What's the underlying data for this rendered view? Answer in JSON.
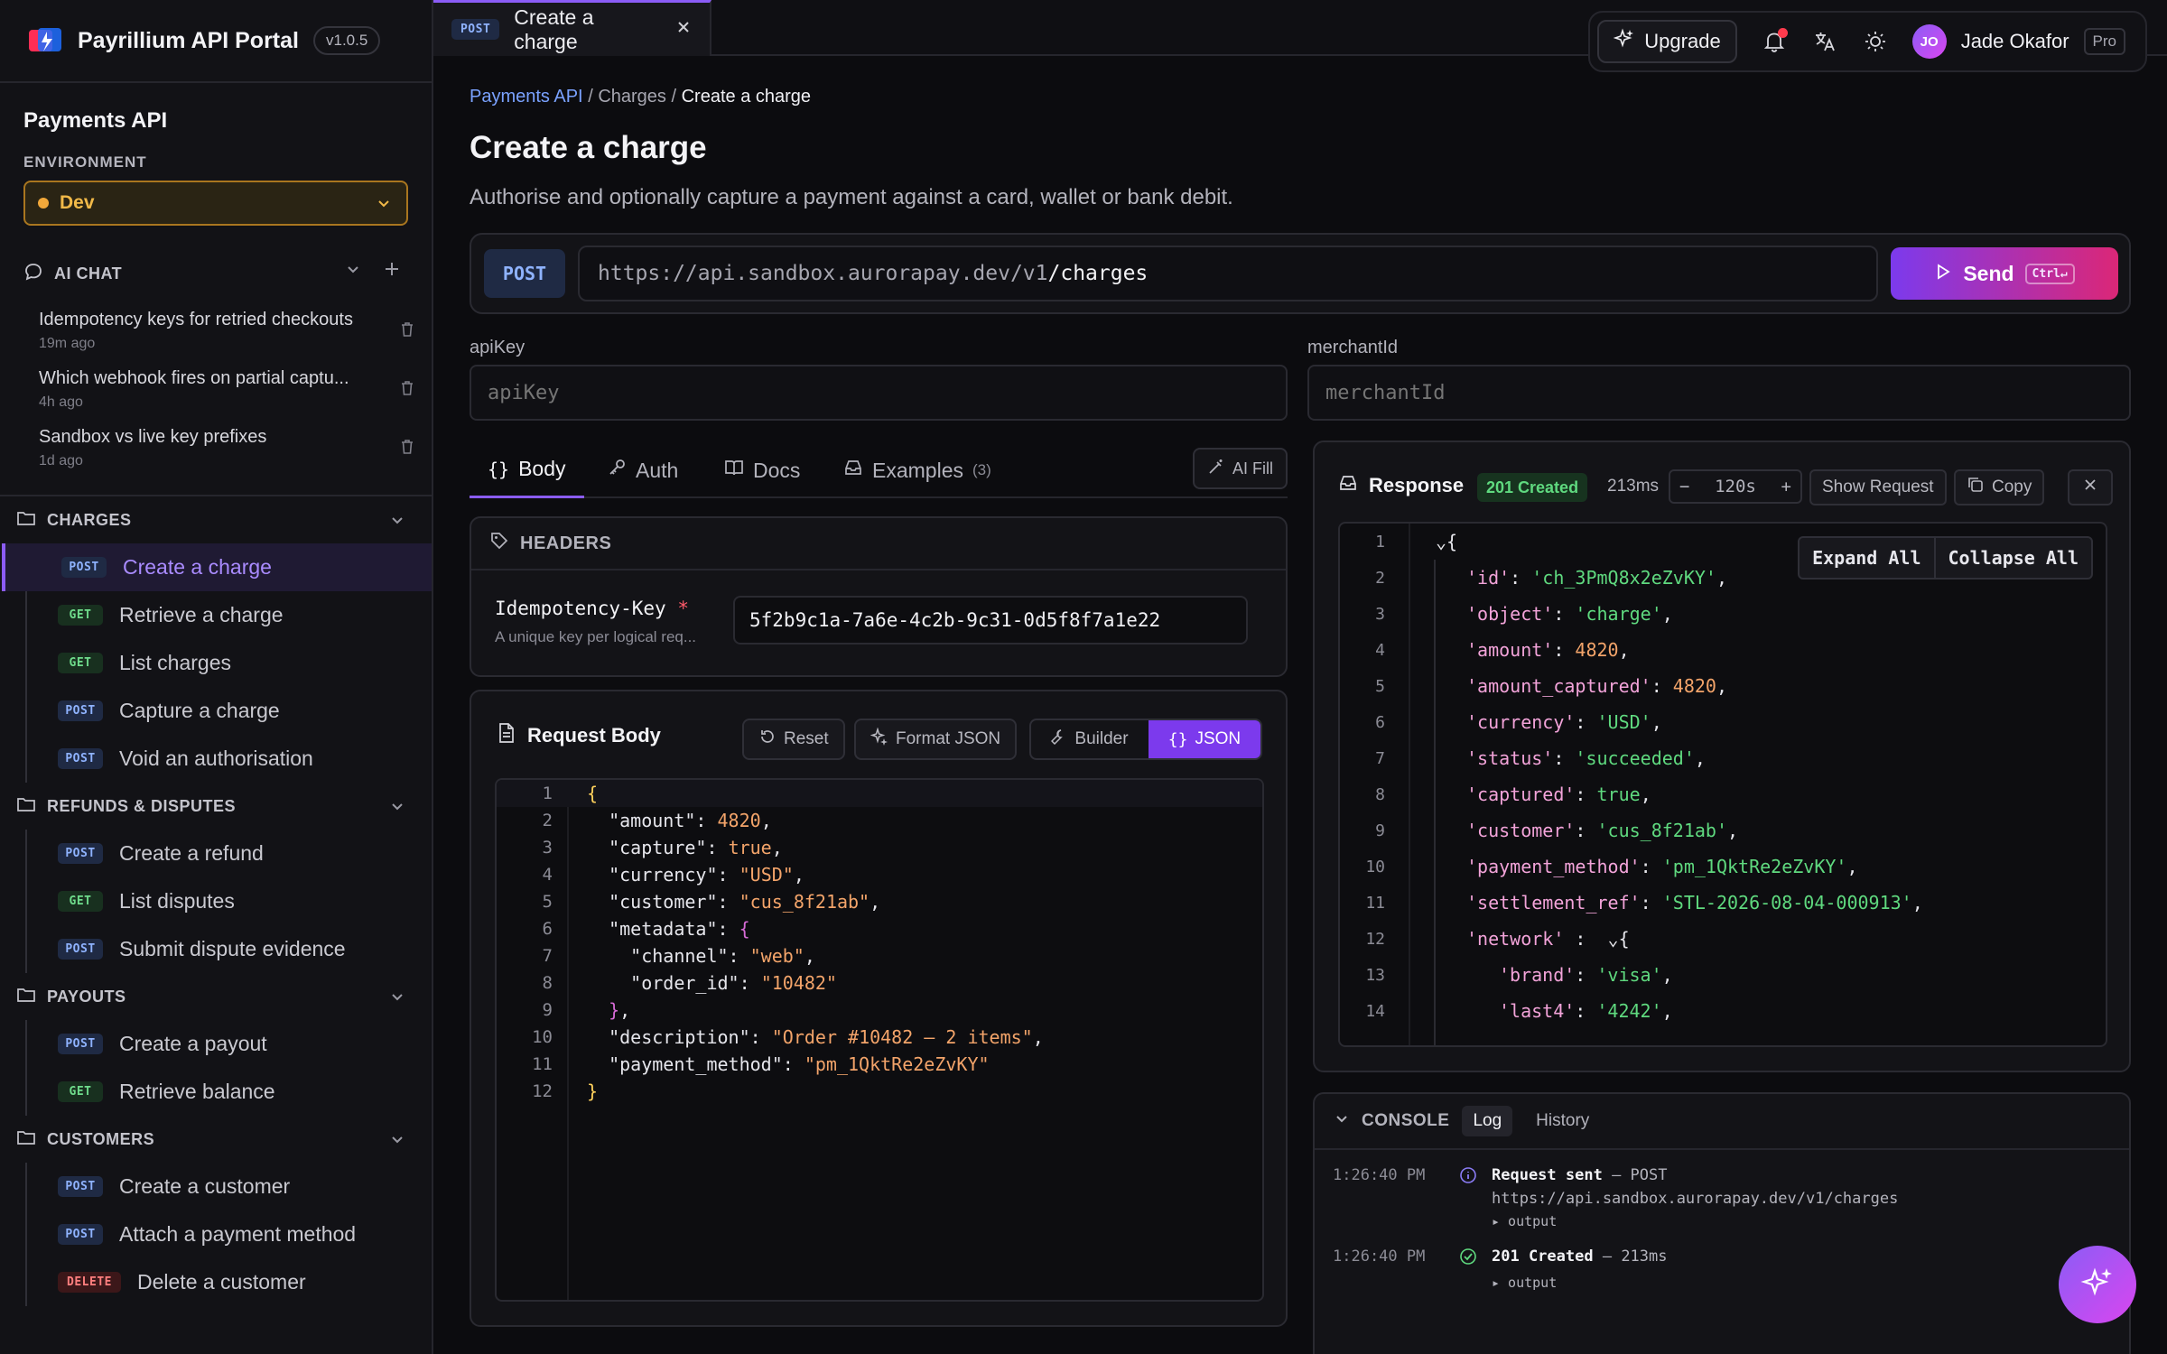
{
  "brand": {
    "name": "Payrillium API Portal",
    "version": "v1.0.5"
  },
  "api": {
    "title": "Payments API",
    "env_label": "ENVIRONMENT",
    "env_value": "Dev"
  },
  "ai_chat": {
    "label": "AI CHAT",
    "items": [
      {
        "title": "Idempotency keys for retried checkouts",
        "time": "19m ago"
      },
      {
        "title": "Which webhook fires on partial captu...",
        "time": "4h ago"
      },
      {
        "title": "Sandbox vs live key prefixes",
        "time": "1d ago"
      }
    ]
  },
  "groups": [
    {
      "title": "CHARGES",
      "items": [
        {
          "method": "POST",
          "label": "Create a charge"
        },
        {
          "method": "GET",
          "label": "Retrieve a charge"
        },
        {
          "method": "GET",
          "label": "List charges"
        },
        {
          "method": "POST",
          "label": "Capture a charge"
        },
        {
          "method": "POST",
          "label": "Void an authorisation"
        }
      ]
    },
    {
      "title": "REFUNDS & DISPUTES",
      "items": [
        {
          "method": "POST",
          "label": "Create a refund"
        },
        {
          "method": "GET",
          "label": "List disputes"
        },
        {
          "method": "POST",
          "label": "Submit dispute evidence"
        }
      ]
    },
    {
      "title": "PAYOUTS",
      "items": [
        {
          "method": "POST",
          "label": "Create a payout"
        },
        {
          "method": "GET",
          "label": "Retrieve balance"
        }
      ]
    },
    {
      "title": "CUSTOMERS",
      "items": [
        {
          "method": "POST",
          "label": "Create a customer"
        },
        {
          "method": "POST",
          "label": "Attach a payment method"
        },
        {
          "method": "DELETE",
          "label": "Delete a customer"
        }
      ]
    }
  ],
  "tab": {
    "method": "POST",
    "label": "Create a charge"
  },
  "topbar": {
    "upgrade": "Upgrade",
    "user": "Jade Okafor",
    "initials": "JO",
    "plan": "Pro"
  },
  "breadcrumb": {
    "root": "Payments API",
    "mid": "Charges",
    "current": "Create a charge",
    "sep": "/"
  },
  "page": {
    "title": "Create a charge",
    "description": "Authorise and optionally capture a payment against a card, wallet or bank debit."
  },
  "request": {
    "method": "POST",
    "url_base": "https://api.sandbox.aurorapay.dev/v1",
    "url_path": "/charges",
    "send": "Send",
    "shortcut": "Ctrl↵"
  },
  "params": [
    {
      "label": "apiKey",
      "placeholder": "apiKey"
    },
    {
      "label": "merchantId",
      "placeholder": "merchantId"
    }
  ],
  "subtabs": {
    "body": "Body",
    "auth": "Auth",
    "docs": "Docs",
    "examples": "Examples",
    "examples_count": "(3)",
    "ai_fill": "AI Fill"
  },
  "headers": {
    "title": "HEADERS",
    "key": "Idempotency-Key",
    "required_mark": "*",
    "hint": "A unique key per logical req...",
    "value": "5f2b9c1a-7a6e-4c2b-9c31-0d5f8f7a1e22"
  },
  "body": {
    "title": "Request Body",
    "reset": "Reset",
    "format": "Format JSON",
    "builder": "Builder",
    "json": "JSON"
  },
  "response": {
    "title": "Response",
    "status": "201 Created",
    "time": "213ms",
    "timeout": "120s",
    "show_request": "Show Request",
    "copy": "Copy",
    "expand_all": "Expand All",
    "collapse_all": "Collapse All"
  },
  "console": {
    "title": "CONSOLE",
    "tab_log": "Log",
    "tab_history": "History",
    "entries": [
      {
        "time": "1:26:40 PM",
        "title": "Request sent",
        "detail": "— POST",
        "url": "https://api.sandbox.aurorapay.dev/v1/charges",
        "toggle": "▸ output"
      },
      {
        "time": "1:26:40 PM",
        "title": "201 Created",
        "detail": "— 213ms",
        "toggle": "▸ output"
      }
    ]
  },
  "colors": {
    "accent": "#8b5cf6",
    "post": "#8fb3ff",
    "get": "#6fdc8c",
    "delete": "#ff7f7f",
    "success": "#5fd97f"
  }
}
